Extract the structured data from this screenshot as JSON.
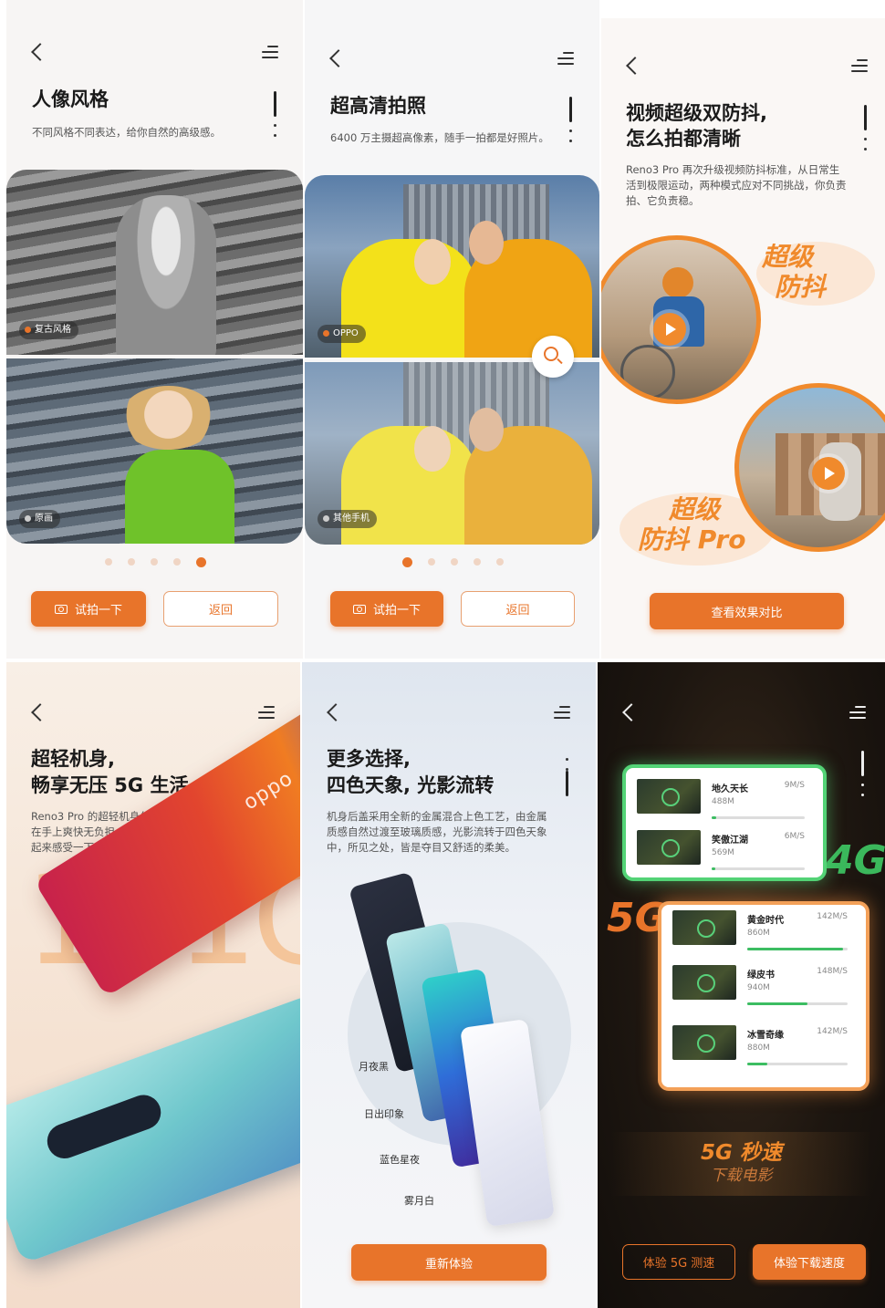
{
  "screens": {
    "portrait": {
      "title": "人像风格",
      "desc": "不同风格不同表达，给你自然的高级感。",
      "photo_top_badge": "复古风格",
      "photo_bottom_badge": "原画",
      "try_button": "试拍一下",
      "back_button": "返回",
      "page_count": 5,
      "active_page": 5
    },
    "hd_photo": {
      "title": "超高清拍照",
      "desc": "6400 万主摄超高像素，随手一拍都是好照片。",
      "photo_top_badge": "OPPO",
      "photo_bottom_badge": "其他手机",
      "try_button": "试拍一下",
      "back_button": "返回",
      "page_count": 5,
      "active_page": 1
    },
    "stabilization": {
      "title_line1": "视频超级双防抖,",
      "title_line2": "怎么拍都清晰",
      "desc": "Reno3 Pro 再次升级视频防抖标准，从日常生活到极限运动，两种模式应对不同挑战，你负责拍、它负责稳。",
      "label_1_line1": "超级",
      "label_1_line2": "防抖",
      "label_2_line1": "超级",
      "label_2_line2": "防抖 Pro",
      "compare_button": "查看效果对比"
    },
    "lightweight": {
      "title_line1": "超轻机身,",
      "title_line2": "畅享无压 5G 生活",
      "desc": "Reno3 Pro 的超轻机身仅有 171g 的重量，握在手上爽快无负担，长时间刷手机也不累，拿起来感受一下吧。",
      "big_number": "171G"
    },
    "colors": {
      "title_line1": "更多选择,",
      "title_line2": "四色天象, 光影流转",
      "desc": "机身后盖采用全新的金属混合上色工艺，由金属质感自然过渡至玻璃质感，光影流转于四色天象中，所见之处，皆是夺目又舒适的柔美。",
      "color_names": [
        "月夜黑",
        "日出印象",
        "蓝色星夜",
        "雾月白"
      ],
      "retry_button": "重新体验"
    },
    "speed_5g": {
      "label_4g": "4G",
      "label_5g": "5G",
      "card_4g_rows": [
        {
          "name": "地久天长",
          "size": "488M",
          "speed": "9M/S",
          "progress": 0.05
        },
        {
          "name": "笑傲江湖",
          "size": "569M",
          "speed": "6M/S",
          "progress": 0.04
        }
      ],
      "card_5g_rows": [
        {
          "name": "黄金时代",
          "size": "860M",
          "speed": "142M/S",
          "progress": 0.95
        },
        {
          "name": "绿皮书",
          "size": "940M",
          "speed": "148M/S",
          "progress": 0.6
        },
        {
          "name": "冰雪奇缘",
          "size": "880M",
          "speed": "142M/S",
          "progress": 0.2
        }
      ],
      "headline": "5G 秒速",
      "subheadline": "下载电影",
      "test_button": "体验 5G 测速",
      "download_button": "体验下载速度"
    }
  },
  "colors": {
    "accent": "#e8742a",
    "accent_soft": "#f08a2c",
    "green": "#3cbd62"
  }
}
